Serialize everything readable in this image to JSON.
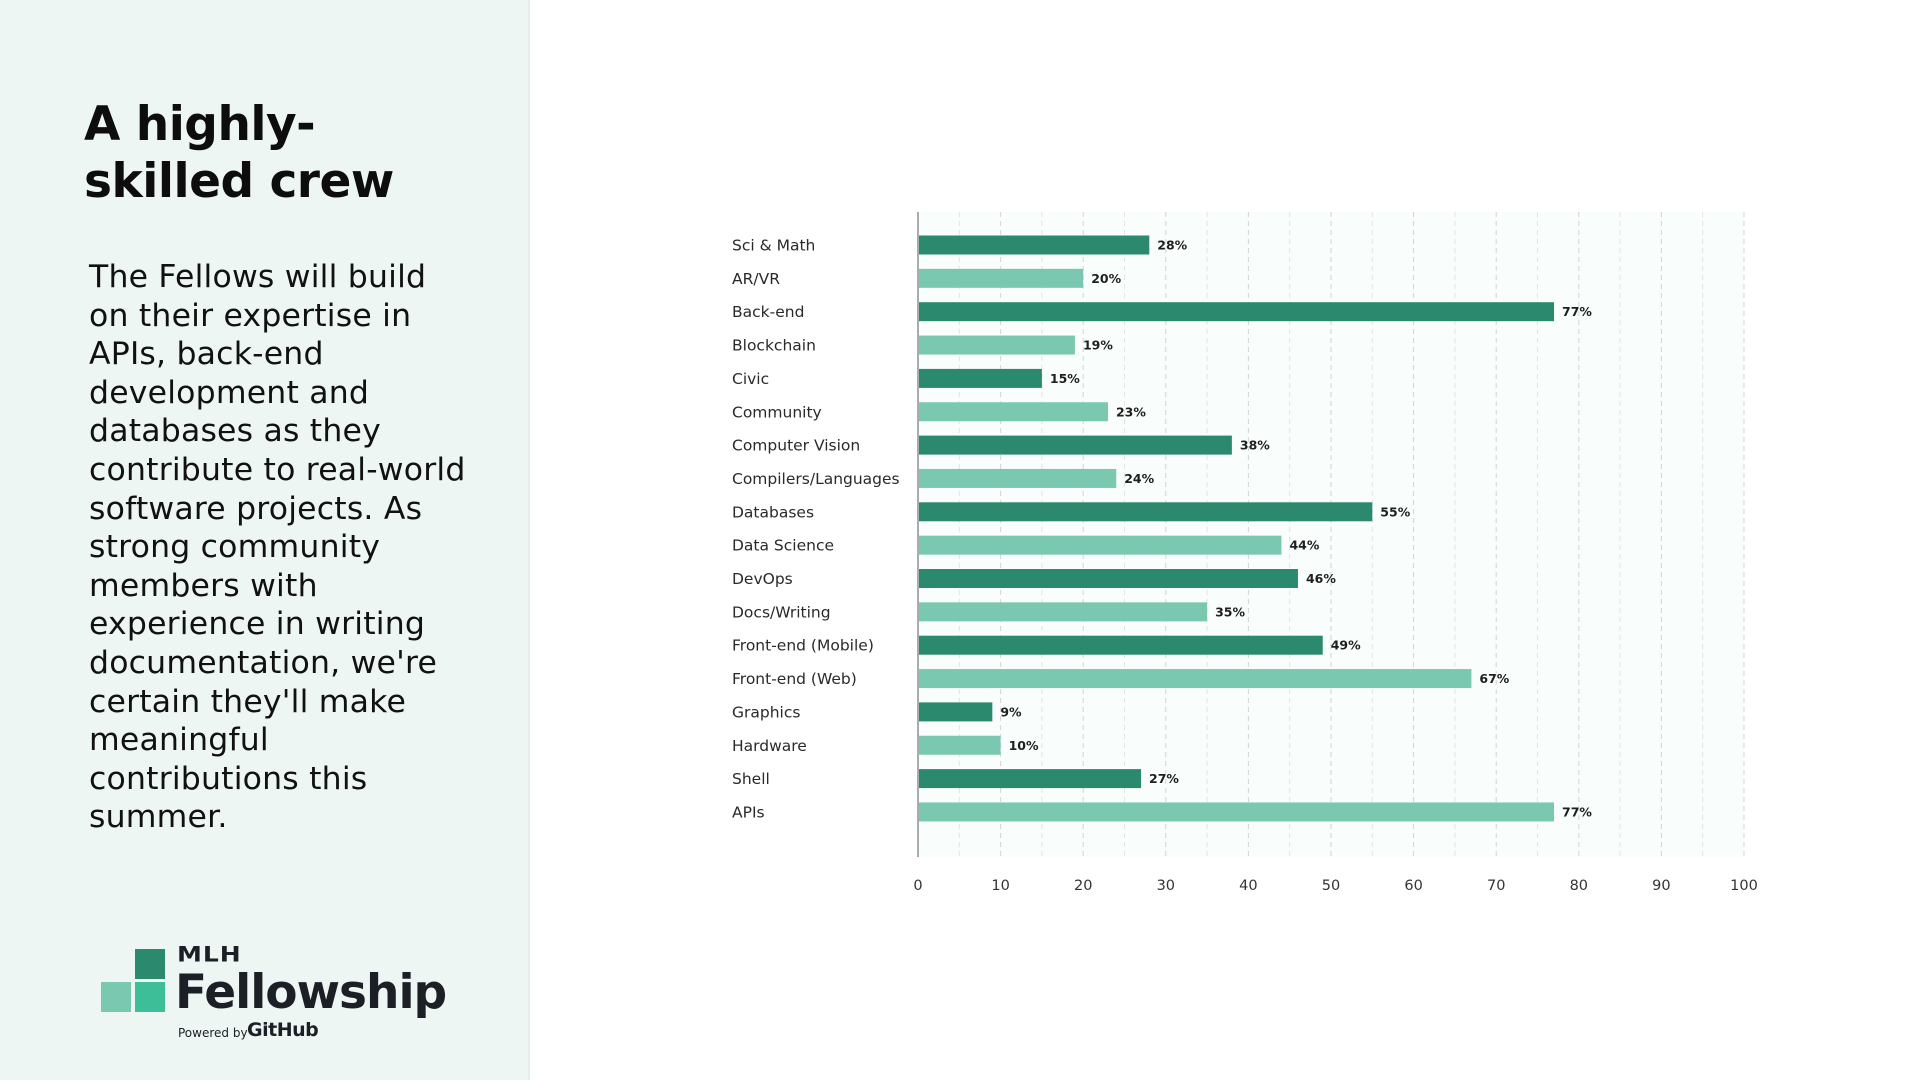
{
  "slide": {
    "title": "A highly-skilled crew",
    "title_lines": [
      "A highly-",
      "skilled crew"
    ],
    "body": "The Fellows will build on their expertise in APIs, back-end development and databases as they contribute to real-world software projects. As strong community members with experience in writing documentation, we're certain they'll make meaningful contributions this summer."
  },
  "logo": {
    "mlh": "MLH",
    "name": "Fellowship",
    "powered_by": "Powered by",
    "github": "GitHub",
    "colors": [
      "#2b8a6e",
      "#7bc8b0",
      "#3dbd98"
    ]
  },
  "colors": {
    "dark_bar": "#2b8a6e",
    "light_bar": "#7bc8b0",
    "panel_bg": "#eef6f3",
    "plot_bg": "#f9fdfb",
    "grid": "#d4d4d4",
    "axis": "#a7acb0"
  },
  "chart_data": {
    "type": "bar",
    "orientation": "horizontal",
    "title": "",
    "xlabel": "",
    "ylabel": "",
    "xlim": [
      0,
      100
    ],
    "xticks": [
      0,
      10,
      20,
      30,
      40,
      50,
      60,
      70,
      80,
      90,
      100
    ],
    "minor_grid_step": 5,
    "grid": true,
    "value_suffix": "%",
    "categories": [
      "Sci & Math",
      "AR/VR",
      "Back-end",
      "Blockchain",
      "Civic",
      "Community",
      "Computer Vision",
      "Compilers/Languages",
      "Databases",
      "Data Science",
      "DevOps",
      "Docs/Writing",
      "Front-end (Mobile)",
      "Front-end (Web)",
      "Graphics",
      "Hardware",
      "Shell",
      "APIs"
    ],
    "values": [
      28,
      20,
      77,
      19,
      15,
      23,
      38,
      24,
      55,
      44,
      46,
      35,
      49,
      67,
      9,
      10,
      27,
      77
    ],
    "data_labels": [
      "28%",
      "20%",
      "77%",
      "19%",
      "15%",
      "23%",
      "38%",
      "24%",
      "55%",
      "44%",
      "46%",
      "35%",
      "49%",
      "67%",
      "9%",
      "10%",
      "27%",
      "77%"
    ],
    "bar_color_pattern": [
      "dark",
      "light"
    ]
  }
}
